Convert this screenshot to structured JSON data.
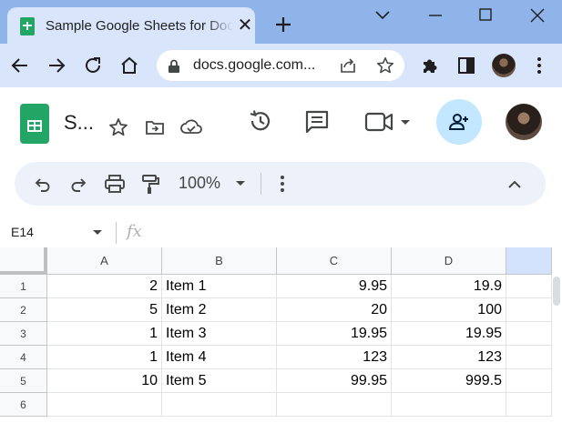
{
  "browser": {
    "tab_title": "Sample Google Sheets for Doc",
    "tab_close": "✕",
    "url": "docs.google.com..."
  },
  "app": {
    "doc_title": "S...",
    "zoom": "100%"
  },
  "formula_bar": {
    "cell_ref": "E14",
    "fx": "fx"
  },
  "sheet": {
    "columns": [
      "A",
      "B",
      "C",
      "D"
    ],
    "selected_column": "E",
    "rows": [
      "1",
      "2",
      "3",
      "4",
      "5",
      "6"
    ],
    "cells": [
      [
        "2",
        "Item 1",
        "9.95",
        "19.9"
      ],
      [
        "5",
        "Item 2",
        "20",
        "100"
      ],
      [
        "1",
        "Item 3",
        "19.95",
        "19.95"
      ],
      [
        "1",
        "Item 4",
        "123",
        "123"
      ],
      [
        "10",
        "Item 5",
        "99.95",
        "999.5"
      ],
      [
        "",
        "",
        "",
        ""
      ]
    ]
  },
  "icons": [
    "sheets-logo-icon",
    "star-icon",
    "move-to-folder-icon",
    "cloud-status-icon",
    "history-icon",
    "comment-icon",
    "meet-icon",
    "share-person-add-icon",
    "undo-icon",
    "redo-icon",
    "print-icon",
    "paint-format-icon",
    "more-vert-icon",
    "collapse-chevron-icon"
  ]
}
